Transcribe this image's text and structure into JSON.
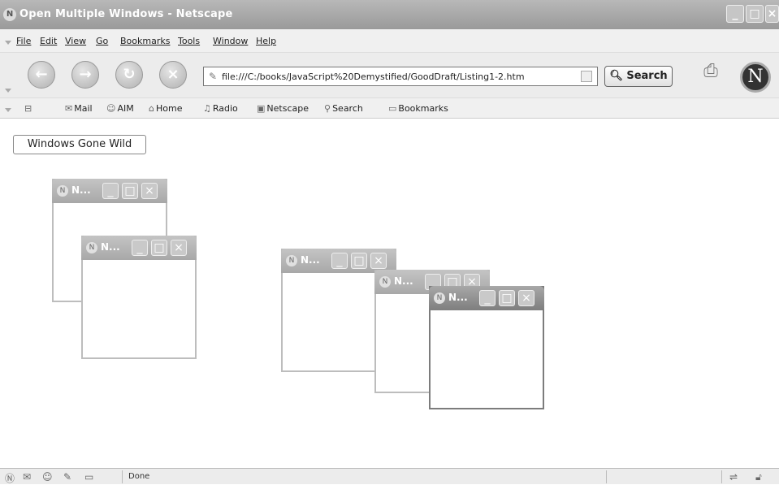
{
  "window": {
    "title": "Open Multiple Windows - Netscape"
  },
  "menu": [
    "File",
    "Edit",
    "View",
    "Go",
    "Bookmarks",
    "Tools",
    "Window",
    "Help"
  ],
  "nav": {
    "url": "file:///C:/books/JavaScript%20Demystified/GoodDraft/Listing1-2.htm",
    "search_label": "Search"
  },
  "personal_toolbar": [
    "Mail",
    "AIM",
    "Home",
    "Radio",
    "Netscape",
    "Search",
    "Bookmarks"
  ],
  "personal_icons": [
    "mail-icon",
    "aim-icon",
    "home-icon",
    "radio-icon",
    "netscape-icon",
    "search-icon",
    "bookmarks-icon"
  ],
  "page": {
    "button_label": "Windows Gone Wild"
  },
  "popups": [
    {
      "title": "N..."
    },
    {
      "title": "N..."
    },
    {
      "title": "N..."
    },
    {
      "title": "N..."
    },
    {
      "title": "N..."
    }
  ],
  "status": {
    "text": "Done"
  }
}
